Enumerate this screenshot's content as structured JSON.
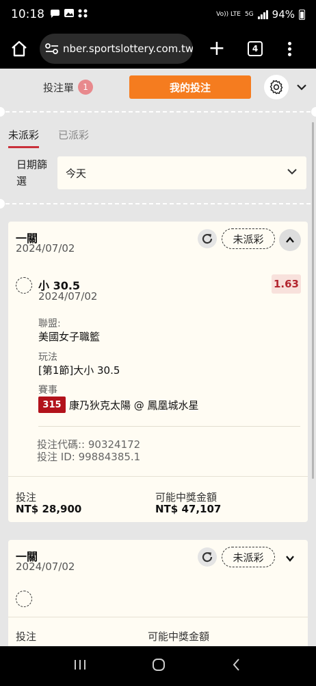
{
  "status_bar": {
    "time": "10:18",
    "notification_icons": "chat-icon photo-icon apps-icon",
    "network_volte": "Vo)) LTE",
    "network_5g": "5G",
    "battery": "94%"
  },
  "browser": {
    "url": "nber.sportslottery.com.tw",
    "tab_count": "4"
  },
  "header": {
    "betslip_label": "投注單",
    "betslip_count": "1",
    "my_bets_label": "我的投注"
  },
  "subtabs": {
    "unsettled": "未派彩",
    "settled": "已派彩"
  },
  "filter": {
    "label": "日期篩選",
    "value": "今天"
  },
  "cards": [
    {
      "title": "一關",
      "date": "2024/07/02",
      "status": "未派彩",
      "pick": "小 30.5",
      "pick_date": "2024/07/02",
      "odds": "1.63",
      "league_label": "聯盟:",
      "league": "美國女子職籃",
      "play_label": "玩法",
      "play": "[第1節]大小 30.5",
      "match_label": "賽事",
      "match_no": "315",
      "match": "康乃狄克太陽 @ 鳳凰城水星",
      "bet_code": "投注代碼:: 90324172",
      "bet_id": "投注 ID: 99884385.1",
      "stake_label": "投注",
      "stake": "NT$ 28,900",
      "payout_label": "可能中獎金額",
      "payout": "NT$ 47,107"
    },
    {
      "title": "一關",
      "date": "2024/07/02",
      "status": "未派彩",
      "stake_label": "投注",
      "payout_label": "可能中獎金額"
    }
  ],
  "colors": {
    "accent_orange": "#f57c1f",
    "odds_red": "#b3262f",
    "game_badge": "#b2121b",
    "card_bg": "#fffcf3"
  }
}
